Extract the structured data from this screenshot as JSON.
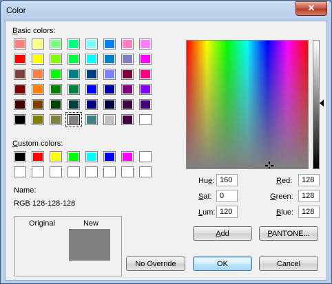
{
  "window": {
    "title": "Color",
    "close_glyph": "✕"
  },
  "basic_colors": {
    "label": "Basic colors:",
    "label_accel": "B",
    "label_rest": "asic colors:",
    "rows": [
      [
        "#ff8080",
        "#ffff80",
        "#80ff80",
        "#00ff80",
        "#80ffff",
        "#0080ff",
        "#ff80c0",
        "#ff80ff"
      ],
      [
        "#ff0000",
        "#ffff00",
        "#80ff00",
        "#00ff40",
        "#00ffff",
        "#0080c0",
        "#8080c0",
        "#ff00ff"
      ],
      [
        "#804040",
        "#ff8040",
        "#00ff00",
        "#008080",
        "#004080",
        "#8080ff",
        "#800040",
        "#ff0080"
      ],
      [
        "#800000",
        "#ff8000",
        "#008000",
        "#008040",
        "#0000ff",
        "#0000a0",
        "#800080",
        "#8000ff"
      ],
      [
        "#400000",
        "#804000",
        "#004000",
        "#004040",
        "#000080",
        "#000040",
        "#400040",
        "#400080"
      ],
      [
        "#000000",
        "#808000",
        "#808040",
        "#808080",
        "#408080",
        "#c0c0c0",
        "#400040",
        "#ffffff"
      ]
    ],
    "selected": "#808080"
  },
  "custom_colors": {
    "label_accel": "C",
    "label_rest": "ustom colors:",
    "rows": [
      [
        "#000000",
        "#ff0000",
        "#ffff00",
        "#00ff00",
        "#00ffff",
        "#0000ff",
        "#ff00ff",
        "#ffffff"
      ],
      [
        "#ffffff",
        "#ffffff",
        "#ffffff",
        "#ffffff",
        "#ffffff",
        "#ffffff",
        "#ffffff",
        "#ffffff"
      ]
    ]
  },
  "name": {
    "label": "Name:",
    "value": "RGB 128-128-128"
  },
  "preview": {
    "original_label": "Original",
    "new_label": "New",
    "new_color": "#808080"
  },
  "hsl": {
    "hue": {
      "accel": "e",
      "pre": "Hu",
      "post": ":",
      "value": "160"
    },
    "sat": {
      "accel": "S",
      "pre": "",
      "post": "at:",
      "value": "0"
    },
    "lum": {
      "accel": "L",
      "pre": "",
      "post": "um:",
      "value": "120"
    }
  },
  "rgb": {
    "red": {
      "accel": "R",
      "post": "ed:",
      "value": "128"
    },
    "green": {
      "accel": "G",
      "post": "reen:",
      "value": "128"
    },
    "blue": {
      "accel": "B",
      "post": "lue:",
      "value": "128"
    }
  },
  "buttons": {
    "add": {
      "accel": "A",
      "post": "dd"
    },
    "pantone": {
      "accel": "P",
      "post": "ANTONE..."
    },
    "no_override": "No Override",
    "ok": "OK",
    "cancel": "Cancel"
  }
}
